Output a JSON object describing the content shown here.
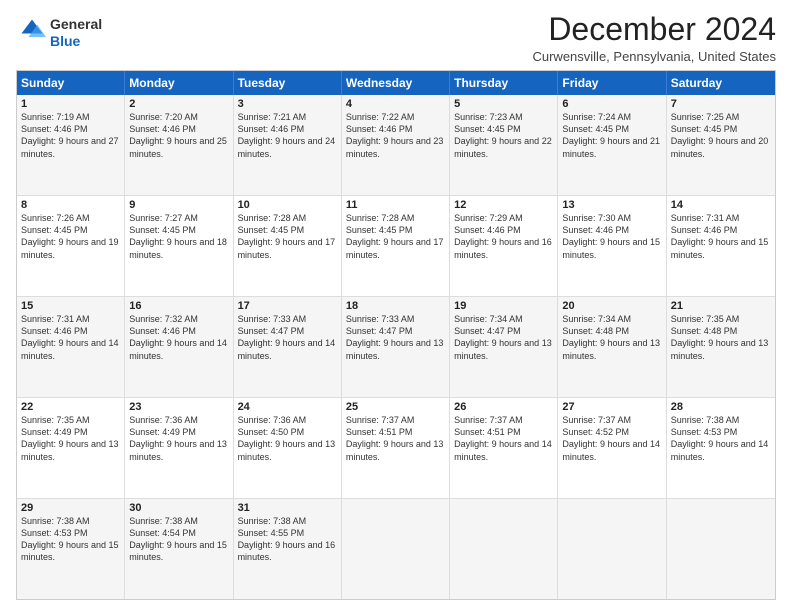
{
  "logo": {
    "general": "General",
    "blue": "Blue"
  },
  "title": "December 2024",
  "location": "Curwensville, Pennsylvania, United States",
  "days_of_week": [
    "Sunday",
    "Monday",
    "Tuesday",
    "Wednesday",
    "Thursday",
    "Friday",
    "Saturday"
  ],
  "weeks": [
    [
      {
        "day": "1",
        "sunrise": "7:19 AM",
        "sunset": "4:46 PM",
        "daylight": "9 hours and 27 minutes."
      },
      {
        "day": "2",
        "sunrise": "7:20 AM",
        "sunset": "4:46 PM",
        "daylight": "9 hours and 25 minutes."
      },
      {
        "day": "3",
        "sunrise": "7:21 AM",
        "sunset": "4:46 PM",
        "daylight": "9 hours and 24 minutes."
      },
      {
        "day": "4",
        "sunrise": "7:22 AM",
        "sunset": "4:46 PM",
        "daylight": "9 hours and 23 minutes."
      },
      {
        "day": "5",
        "sunrise": "7:23 AM",
        "sunset": "4:45 PM",
        "daylight": "9 hours and 22 minutes."
      },
      {
        "day": "6",
        "sunrise": "7:24 AM",
        "sunset": "4:45 PM",
        "daylight": "9 hours and 21 minutes."
      },
      {
        "day": "7",
        "sunrise": "7:25 AM",
        "sunset": "4:45 PM",
        "daylight": "9 hours and 20 minutes."
      }
    ],
    [
      {
        "day": "8",
        "sunrise": "7:26 AM",
        "sunset": "4:45 PM",
        "daylight": "9 hours and 19 minutes."
      },
      {
        "day": "9",
        "sunrise": "7:27 AM",
        "sunset": "4:45 PM",
        "daylight": "9 hours and 18 minutes."
      },
      {
        "day": "10",
        "sunrise": "7:28 AM",
        "sunset": "4:45 PM",
        "daylight": "9 hours and 17 minutes."
      },
      {
        "day": "11",
        "sunrise": "7:28 AM",
        "sunset": "4:45 PM",
        "daylight": "9 hours and 17 minutes."
      },
      {
        "day": "12",
        "sunrise": "7:29 AM",
        "sunset": "4:46 PM",
        "daylight": "9 hours and 16 minutes."
      },
      {
        "day": "13",
        "sunrise": "7:30 AM",
        "sunset": "4:46 PM",
        "daylight": "9 hours and 15 minutes."
      },
      {
        "day": "14",
        "sunrise": "7:31 AM",
        "sunset": "4:46 PM",
        "daylight": "9 hours and 15 minutes."
      }
    ],
    [
      {
        "day": "15",
        "sunrise": "7:31 AM",
        "sunset": "4:46 PM",
        "daylight": "9 hours and 14 minutes."
      },
      {
        "day": "16",
        "sunrise": "7:32 AM",
        "sunset": "4:46 PM",
        "daylight": "9 hours and 14 minutes."
      },
      {
        "day": "17",
        "sunrise": "7:33 AM",
        "sunset": "4:47 PM",
        "daylight": "9 hours and 14 minutes."
      },
      {
        "day": "18",
        "sunrise": "7:33 AM",
        "sunset": "4:47 PM",
        "daylight": "9 hours and 13 minutes."
      },
      {
        "day": "19",
        "sunrise": "7:34 AM",
        "sunset": "4:47 PM",
        "daylight": "9 hours and 13 minutes."
      },
      {
        "day": "20",
        "sunrise": "7:34 AM",
        "sunset": "4:48 PM",
        "daylight": "9 hours and 13 minutes."
      },
      {
        "day": "21",
        "sunrise": "7:35 AM",
        "sunset": "4:48 PM",
        "daylight": "9 hours and 13 minutes."
      }
    ],
    [
      {
        "day": "22",
        "sunrise": "7:35 AM",
        "sunset": "4:49 PM",
        "daylight": "9 hours and 13 minutes."
      },
      {
        "day": "23",
        "sunrise": "7:36 AM",
        "sunset": "4:49 PM",
        "daylight": "9 hours and 13 minutes."
      },
      {
        "day": "24",
        "sunrise": "7:36 AM",
        "sunset": "4:50 PM",
        "daylight": "9 hours and 13 minutes."
      },
      {
        "day": "25",
        "sunrise": "7:37 AM",
        "sunset": "4:51 PM",
        "daylight": "9 hours and 13 minutes."
      },
      {
        "day": "26",
        "sunrise": "7:37 AM",
        "sunset": "4:51 PM",
        "daylight": "9 hours and 14 minutes."
      },
      {
        "day": "27",
        "sunrise": "7:37 AM",
        "sunset": "4:52 PM",
        "daylight": "9 hours and 14 minutes."
      },
      {
        "day": "28",
        "sunrise": "7:38 AM",
        "sunset": "4:53 PM",
        "daylight": "9 hours and 14 minutes."
      }
    ],
    [
      {
        "day": "29",
        "sunrise": "7:38 AM",
        "sunset": "4:53 PM",
        "daylight": "9 hours and 15 minutes."
      },
      {
        "day": "30",
        "sunrise": "7:38 AM",
        "sunset": "4:54 PM",
        "daylight": "9 hours and 15 minutes."
      },
      {
        "day": "31",
        "sunrise": "7:38 AM",
        "sunset": "4:55 PM",
        "daylight": "9 hours and 16 minutes."
      },
      null,
      null,
      null,
      null
    ]
  ],
  "labels": {
    "sunrise": "Sunrise:",
    "sunset": "Sunset:",
    "daylight": "Daylight:"
  }
}
